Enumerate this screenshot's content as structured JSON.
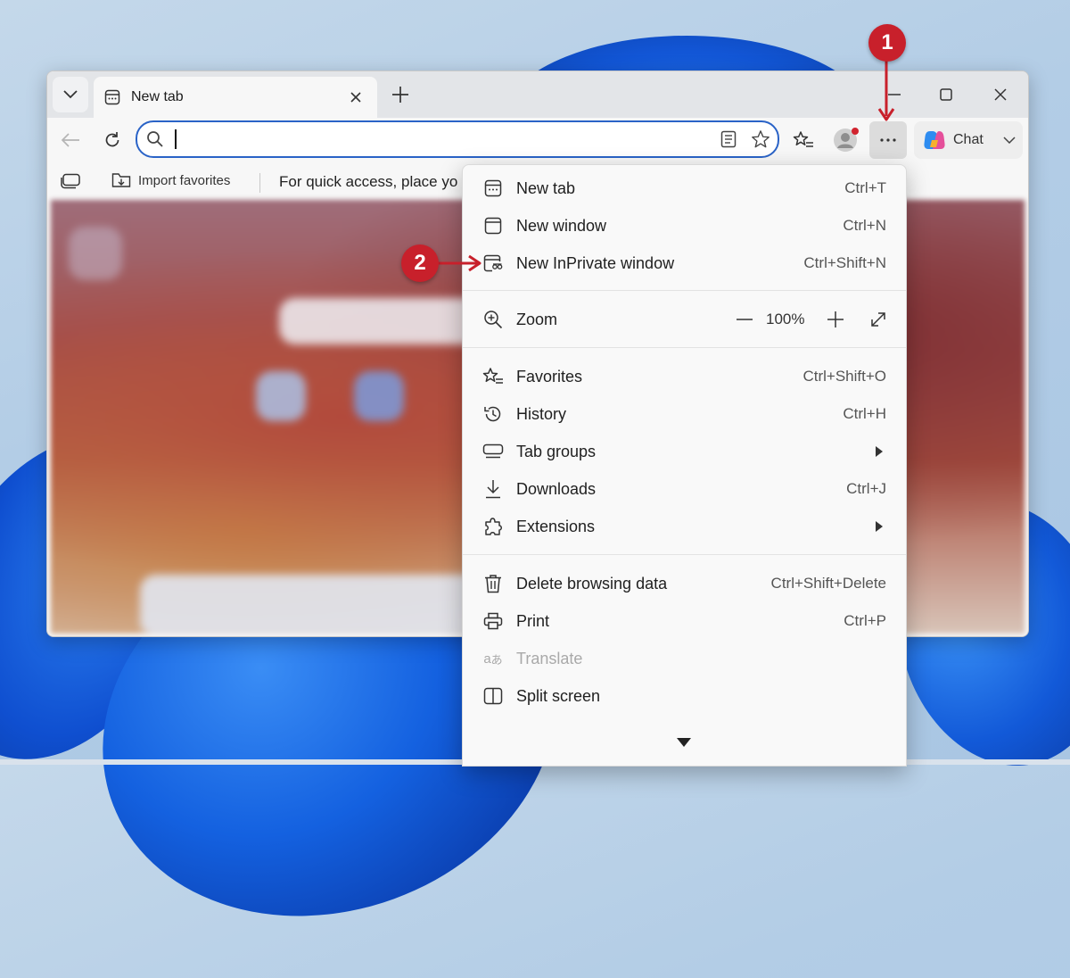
{
  "browser": {
    "tab": {
      "title": "New tab"
    },
    "address_bar": {
      "value": "",
      "placeholder": ""
    },
    "chat_label": "Chat",
    "favorites_bar": {
      "import_label": "Import favorites",
      "hint": "For quick access, place yo"
    }
  },
  "menu": {
    "items": [
      {
        "label": "New tab",
        "shortcut": "Ctrl+T"
      },
      {
        "label": "New window",
        "shortcut": "Ctrl+N"
      },
      {
        "label": "New InPrivate window",
        "shortcut": "Ctrl+Shift+N"
      },
      {
        "label": "Zoom",
        "value": "100%"
      },
      {
        "label": "Favorites",
        "shortcut": "Ctrl+Shift+O"
      },
      {
        "label": "History",
        "shortcut": "Ctrl+H"
      },
      {
        "label": "Tab groups"
      },
      {
        "label": "Downloads",
        "shortcut": "Ctrl+J"
      },
      {
        "label": "Extensions"
      },
      {
        "label": "Delete browsing data",
        "shortcut": "Ctrl+Shift+Delete"
      },
      {
        "label": "Print",
        "shortcut": "Ctrl+P"
      },
      {
        "label": "Translate",
        "disabled": true
      },
      {
        "label": "Split screen"
      }
    ]
  },
  "annotations": {
    "step1": "1",
    "step2": "2"
  },
  "colors": {
    "accent": "#2a63c7",
    "callout": "#c8202b"
  }
}
